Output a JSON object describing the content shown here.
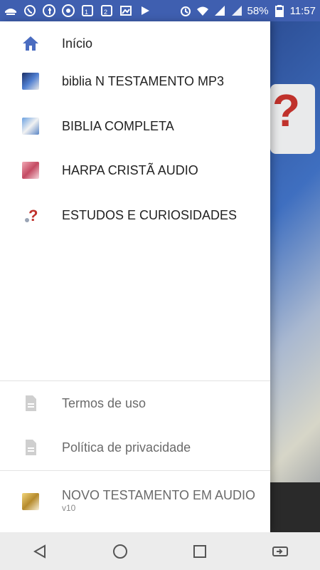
{
  "status_bar": {
    "battery_percent": "58%",
    "time": "11:57",
    "icons": [
      "notification-icon",
      "whatsapp-icon",
      "facebook-icon",
      "chrome-icon",
      "sim1-icon",
      "sim2-icon",
      "image-icon",
      "play-store-icon",
      "alarm-icon",
      "wifi-icon",
      "signal-icon",
      "signal-icon-2",
      "battery-icon"
    ]
  },
  "drawer": {
    "items": [
      {
        "label": "Início",
        "icon": "home-icon"
      },
      {
        "label": "biblia N TESTAMENTO MP3",
        "icon": "bible-thumbnail-icon"
      },
      {
        "label": "BIBLIA COMPLETA",
        "icon": "bible-complete-thumbnail-icon"
      },
      {
        "label": "HARPA CRISTÃ AUDIO",
        "icon": "harpa-thumbnail-icon"
      },
      {
        "label": "ESTUDOS E CURIOSIDADES",
        "icon": "question-icon"
      }
    ],
    "footer_items": [
      {
        "label": "Termos de uso",
        "icon": "document-icon"
      },
      {
        "label": "Política de privacidade",
        "icon": "document-icon"
      }
    ],
    "app": {
      "name": "NOVO TESTAMENTO EM AUDIO",
      "version": "v10",
      "icon": "app-book-icon"
    }
  },
  "background": {
    "accent_question": "?",
    "primary_color": "#3f5fb0"
  },
  "navbar": {
    "buttons": [
      "back-icon",
      "home-circle-icon",
      "recents-icon",
      "switch-apps-icon"
    ]
  }
}
